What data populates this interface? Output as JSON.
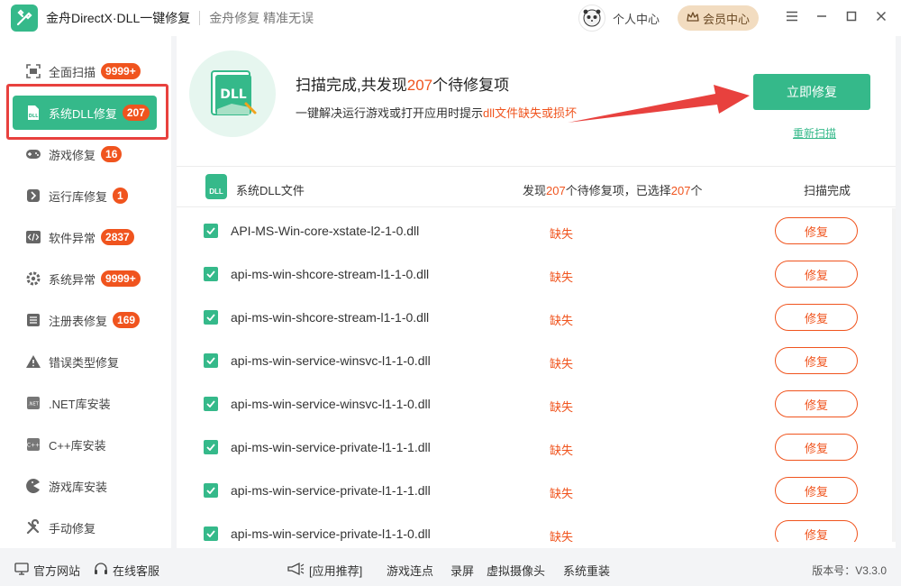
{
  "titlebar": {
    "app_title": "金舟DirectX·DLL一键修复",
    "slogan": "金舟修复 精准无误",
    "user_center": "个人中心",
    "vip_center": "会员中心"
  },
  "sidebar": {
    "items": [
      {
        "label": "全面扫描",
        "badge": "9999+",
        "icon": "scan-icon"
      },
      {
        "label": "系统DLL修复",
        "badge": "207",
        "icon": "dll-icon"
      },
      {
        "label": "游戏修复",
        "badge": "16",
        "icon": "gamepad-icon"
      },
      {
        "label": "运行库修复",
        "badge": "1",
        "icon": "runtime-icon"
      },
      {
        "label": "软件异常",
        "badge": "2837",
        "icon": "code-icon"
      },
      {
        "label": "系统异常",
        "badge": "9999+",
        "icon": "gear-icon"
      },
      {
        "label": "注册表修复",
        "badge": "169",
        "icon": "list-icon"
      },
      {
        "label": "错误类型修复",
        "badge": "",
        "icon": "warning-icon"
      },
      {
        "label": ".NET库安装",
        "badge": "",
        "icon": "dotnet-icon"
      },
      {
        "label": "C++库安装",
        "badge": "",
        "icon": "cpp-icon"
      },
      {
        "label": "游戏库安装",
        "badge": "",
        "icon": "pacman-icon"
      },
      {
        "label": "手动修复",
        "badge": "",
        "icon": "tools-icon"
      }
    ],
    "active_index": 1
  },
  "hero": {
    "title_prefix": "扫描完成,共发现",
    "title_count": "207",
    "title_suffix": "个待修复项",
    "sub_prefix": "一键解决运行游戏或打开应用时提示",
    "sub_highlight": "dll文件缺失或损坏",
    "fix_now": "立即修复",
    "rescan": "重新扫描",
    "icon_text": "DLL"
  },
  "list_header": {
    "icon_text": "DLL",
    "title": "系统DLL文件",
    "stats_a": "发现",
    "found": "207",
    "stats_b": "个待修复项，已选择",
    "selected": "207",
    "stats_c": "个",
    "status": "扫描完成"
  },
  "rows": [
    {
      "name": "API-MS-Win-core-xstate-l2-1-0.dll",
      "status": "缺失",
      "action": "修复"
    },
    {
      "name": "api-ms-win-shcore-stream-l1-1-0.dll",
      "status": "缺失",
      "action": "修复"
    },
    {
      "name": "api-ms-win-shcore-stream-l1-1-0.dll",
      "status": "缺失",
      "action": "修复"
    },
    {
      "name": "api-ms-win-service-winsvc-l1-1-0.dll",
      "status": "缺失",
      "action": "修复"
    },
    {
      "name": "api-ms-win-service-winsvc-l1-1-0.dll",
      "status": "缺失",
      "action": "修复"
    },
    {
      "name": "api-ms-win-service-private-l1-1-1.dll",
      "status": "缺失",
      "action": "修复"
    },
    {
      "name": "api-ms-win-service-private-l1-1-1.dll",
      "status": "缺失",
      "action": "修复"
    },
    {
      "name": "api-ms-win-service-private-l1-1-0.dll",
      "status": "缺失",
      "action": "修复"
    }
  ],
  "footer": {
    "official_site": "官方网站",
    "online_service": "在线客服",
    "recommend": "[应用推荐]",
    "links": [
      "游戏连点",
      "录屏",
      "虚拟摄像头",
      "系统重装"
    ],
    "version": "版本号：V3.3.0"
  },
  "colors": {
    "accent": "#35b98a",
    "warning": "#f0541e",
    "highlight_box": "#e8413e"
  }
}
